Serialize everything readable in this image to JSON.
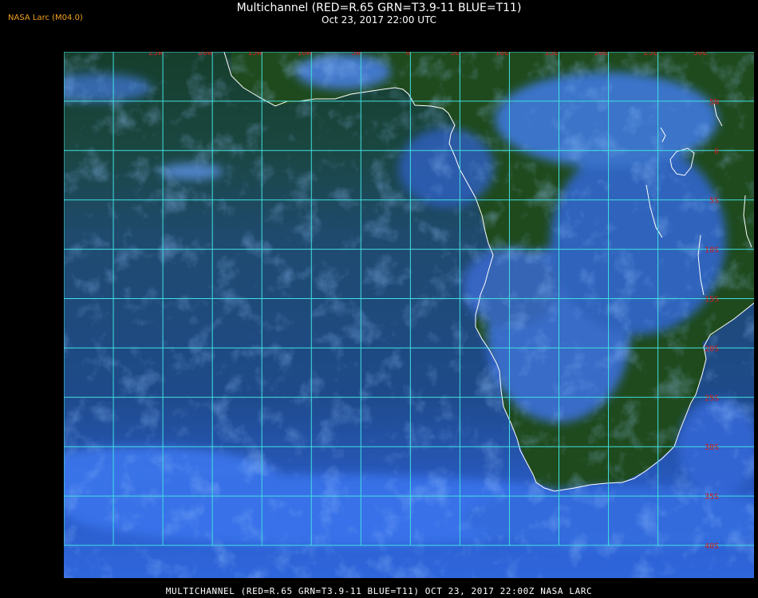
{
  "header": {
    "source_label": "NASA Larc (M04.0)",
    "title": "Multichannel (RED=R.65 GRN=T3.9-11 BLUE=T11)",
    "subtitle": "Oct 23, 2017 22:00 UTC"
  },
  "footer": {
    "caption": "MULTICHANNEL (RED=R.65 GRN=T3.9-11 BLUE=T11) OCT 23, 2017 22:00Z   NASA LARC"
  },
  "map": {
    "longitude_labels": [
      "25W",
      "20W",
      "15W",
      "10W",
      "5W",
      "0",
      "5E",
      "10E",
      "15E",
      "20E",
      "25E",
      "30E",
      "35E"
    ],
    "latitude_labels": [
      "5N",
      "0",
      "5S",
      "10S",
      "15S",
      "20S",
      "25S",
      "30S",
      "35S",
      "40S"
    ],
    "colors": {
      "grid": "#40e0e0",
      "coastline": "#ffffff",
      "grid_label": "#c82020",
      "title": "#ffffff",
      "source_label": "#f0a020",
      "background": "#000000"
    }
  }
}
